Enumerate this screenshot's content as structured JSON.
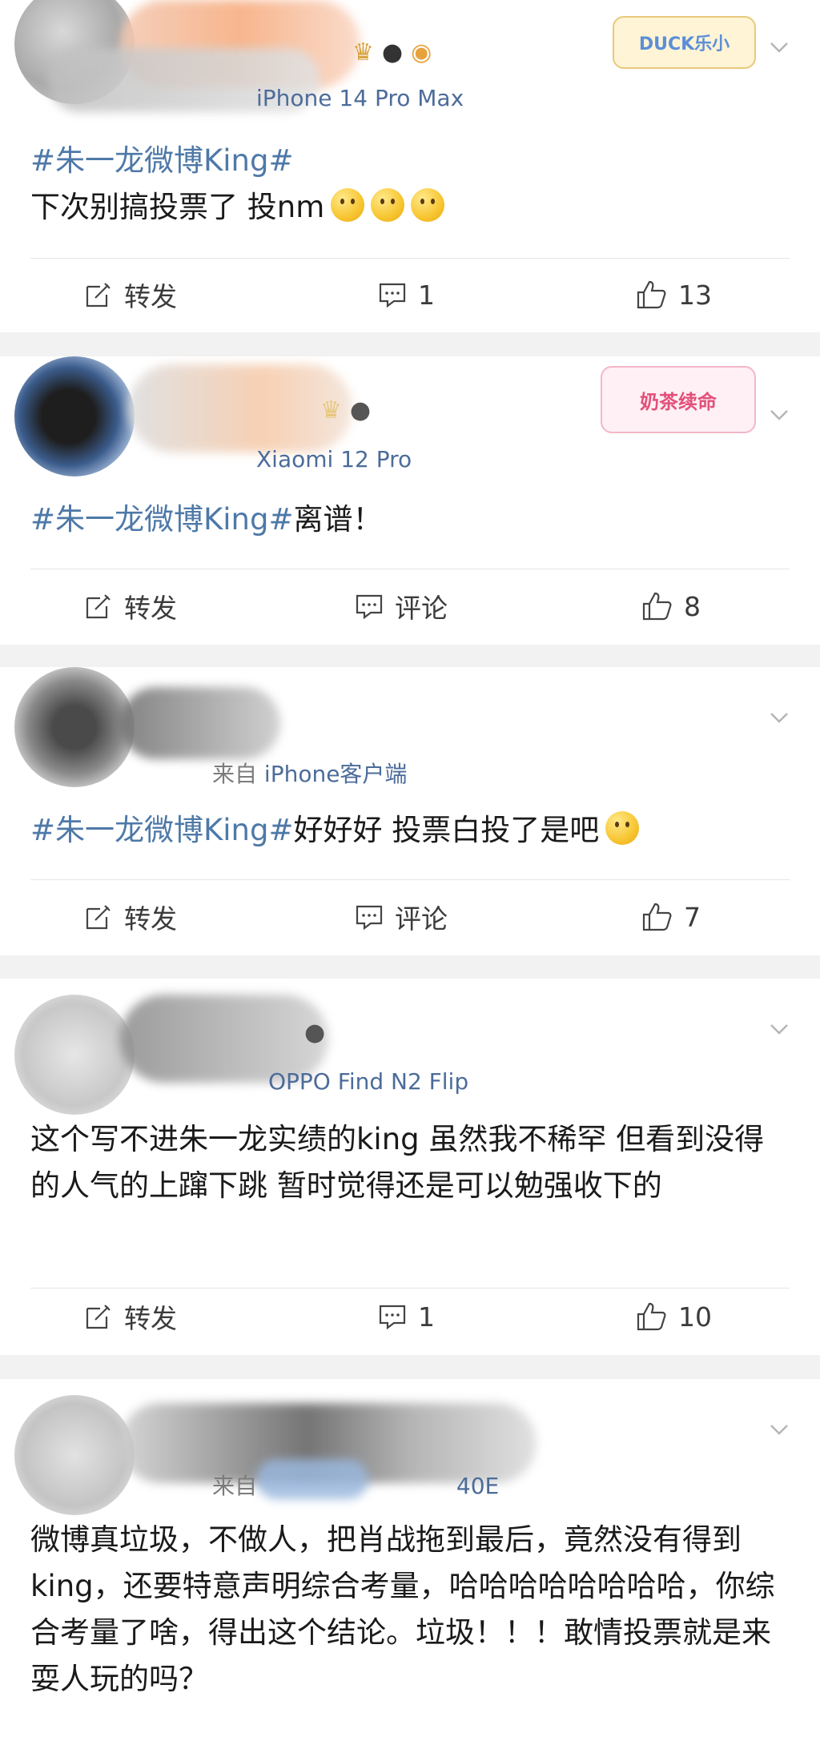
{
  "posts": [
    {
      "source": "iPhone 14 Pro Max",
      "text_hashtag": "#朱一龙微博King#",
      "text": "下次别搞投票了 投nm",
      "emoji_count": 3,
      "repost_label": "转发",
      "comment_label": "1",
      "like_count": "13",
      "deco_label": "DUCK乐小"
    },
    {
      "source": "Xiaomi 12 Pro",
      "text_hashtag": "#朱一龙微博King#",
      "text": "离谱！",
      "repost_label": "转发",
      "comment_label": "评论",
      "like_count": "8",
      "deco_label": "奶茶续命"
    },
    {
      "source_prefix": "来自",
      "source": "iPhone客户端",
      "text_hashtag": "#朱一龙微博King#",
      "text": "好好好 投票白投了是吧",
      "emoji_count": 1,
      "repost_label": "转发",
      "comment_label": "评论",
      "like_count": "7"
    },
    {
      "source": "OPPO Find N2 Flip",
      "text": "这个写不进朱一龙实绩的king 虽然我不稀罕 但看到没得的人气的上蹿下跳 暂时觉得还是可以勉强收下的",
      "repost_label": "转发",
      "comment_label": "1",
      "like_count": "10"
    },
    {
      "source_prefix": "来自",
      "source": "40E",
      "text": "微博真垃圾，不做人，把肖战拖到最后，竟然没有得到king，还要特意声明综合考量，哈哈哈哈哈哈哈哈，你综合考量了啥，得出这个结论。垃圾！！！敢情投票就是来耍人玩的吗？"
    }
  ],
  "icons": {
    "repost": "edit-icon",
    "comment": "comment-icon",
    "like": "thumb-up-icon",
    "more": "chevron-down-icon"
  },
  "colors": {
    "hashtag": "#4e79a8",
    "source": "#4c6c9a",
    "meta": "#7c7c7c",
    "background": "#f2f2f2"
  }
}
